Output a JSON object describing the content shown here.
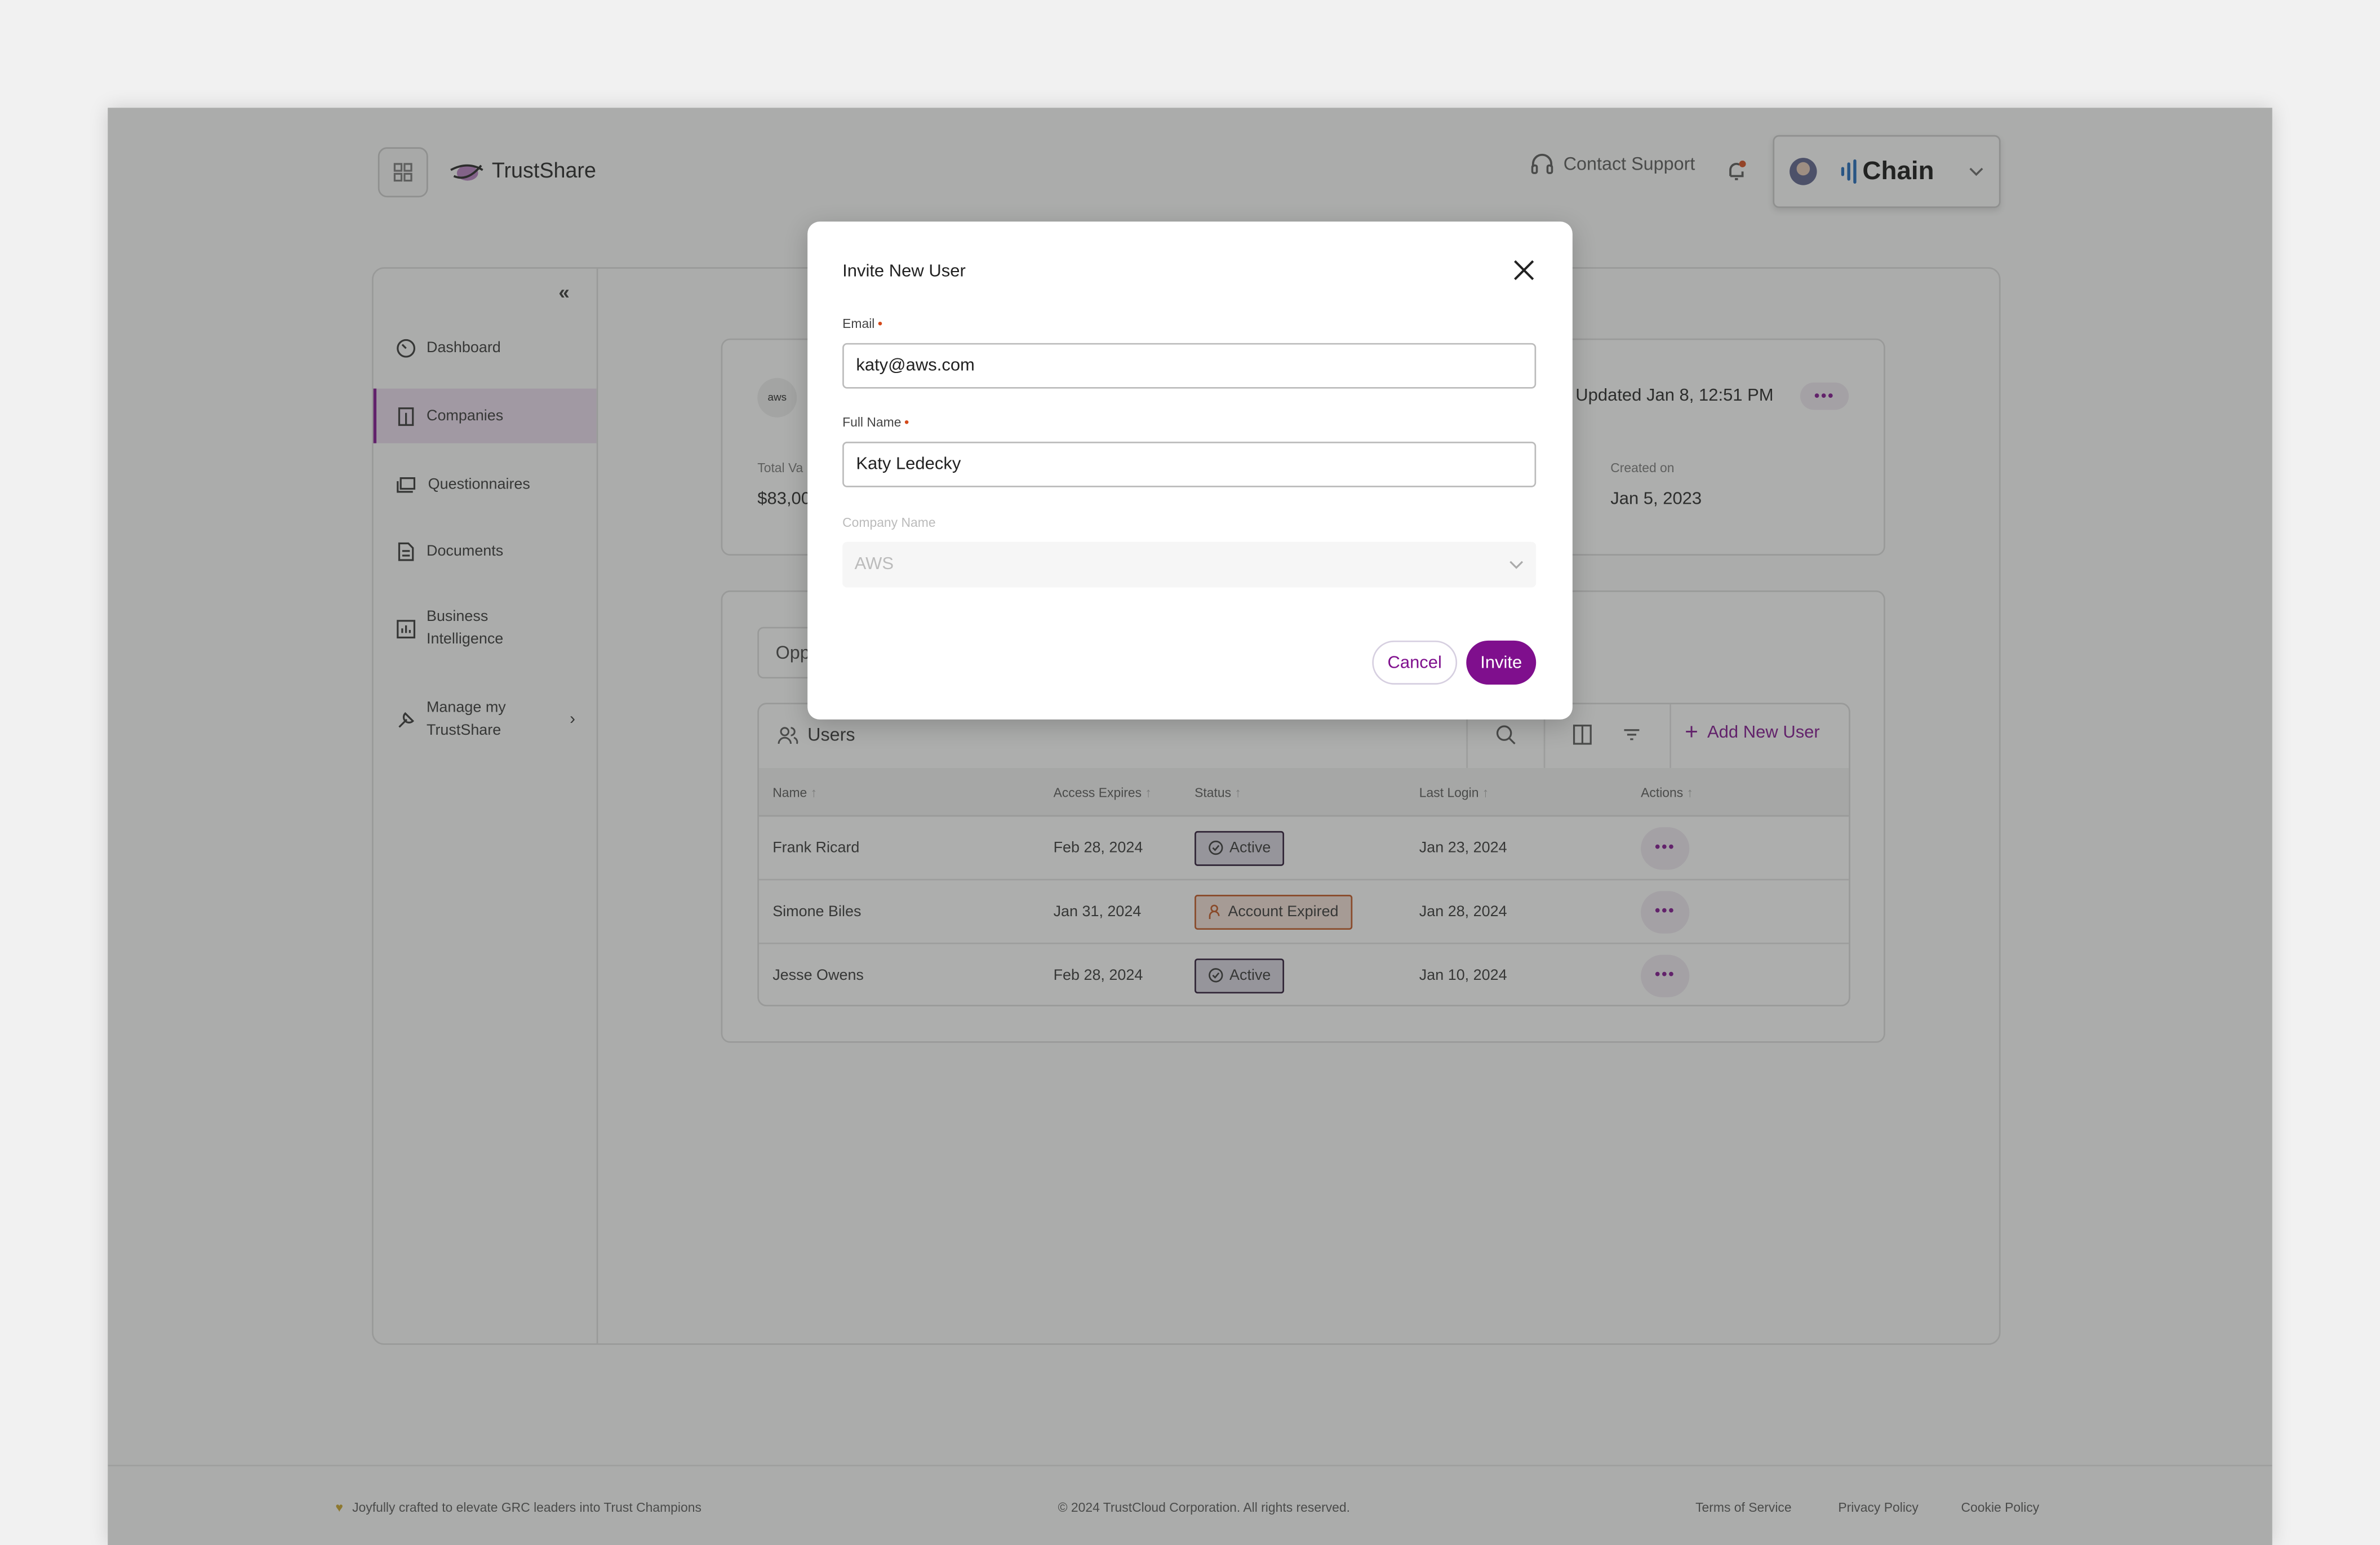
{
  "header": {
    "brand": "TrustShare",
    "contact_support": "Contact Support",
    "account_name": "Chain"
  },
  "sidebar": {
    "items": [
      {
        "label": "Dashboard",
        "icon": "dashboard-gauge-icon"
      },
      {
        "label": "Companies",
        "icon": "building-icon",
        "active": true
      },
      {
        "label": "Questionnaires",
        "icon": "questionnaire-icon"
      },
      {
        "label": "Documents",
        "icon": "document-icon"
      },
      {
        "label": "Business",
        "label2": "Intelligence",
        "icon": "chart-icon"
      },
      {
        "label": "Manage my",
        "label2": "TrustShare",
        "icon": "tools-icon"
      }
    ]
  },
  "company": {
    "logo": "aws",
    "updated": "Updated Jan 8, 12:51 PM",
    "total_label": "Total Va",
    "total_value": "$83,00",
    "created_label": "Created on",
    "created_value": "Jan 5, 2023"
  },
  "tab": "Opp",
  "users": {
    "title": "Users",
    "add_label": "Add New User",
    "columns": [
      "Name",
      "Access Expires",
      "Status",
      "Last Login",
      "Actions"
    ],
    "rows": [
      {
        "name": "Frank Ricard",
        "expires": "Feb 28, 2024",
        "status": "Active",
        "last_login": "Jan 23, 2024"
      },
      {
        "name": "Simone Biles",
        "expires": "Jan 31, 2024",
        "status": "Account Expired",
        "last_login": "Jan 28, 2024"
      },
      {
        "name": "Jesse Owens",
        "expires": "Feb 28, 2024",
        "status": "Active",
        "last_login": "Jan 10, 2024"
      }
    ]
  },
  "footer": {
    "tagline": "Joyfully crafted to elevate GRC leaders into Trust Champions",
    "copyright": "© 2024 TrustCloud Corporation. All rights reserved.",
    "links": [
      "Terms of Service",
      "Privacy Policy",
      "Cookie Policy"
    ]
  },
  "modal": {
    "title": "Invite New User",
    "email_label": "Email",
    "email_value": "katy@aws.com",
    "name_label": "Full Name",
    "name_value": "Katy Ledecky",
    "company_label": "Company Name",
    "company_value": "AWS",
    "cancel": "Cancel",
    "invite": "Invite"
  },
  "colors": {
    "accent": "#7f0f8d",
    "required": "#d4491a",
    "expired": "#c2531e"
  }
}
